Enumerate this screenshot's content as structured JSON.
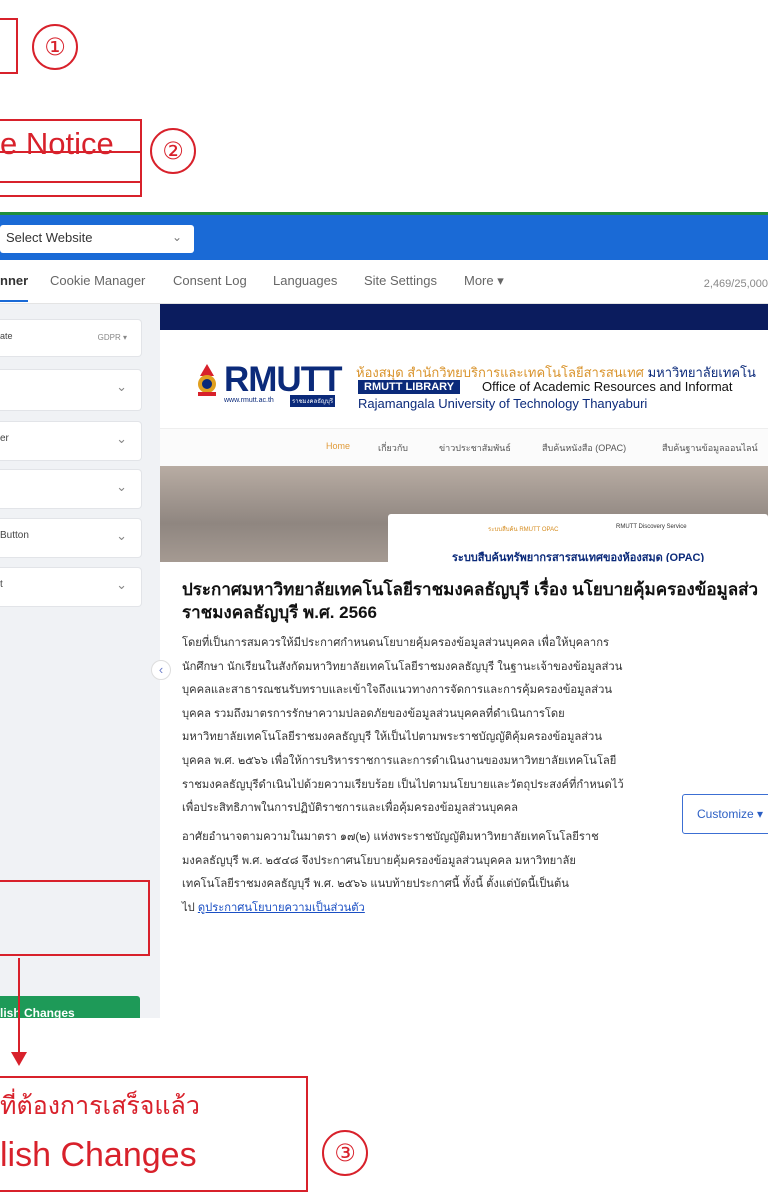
{
  "annotations": {
    "step1_number": "①",
    "step2_label": "e Notice",
    "step2_number": "②",
    "step3_line1": "ที่ต้องการเสร็จแล้ว",
    "step3_line2": "lish Changes",
    "step3_number": "③",
    "color": "#d8212b"
  },
  "topbar": {
    "website_select": "Select Website",
    "accent_color": "#1a6ad6"
  },
  "nav": {
    "tabs": [
      "nner",
      "Cookie Manager",
      "Consent Log",
      "Languages",
      "Site Settings",
      "More ▾"
    ],
    "usage": "2,469/25,000"
  },
  "left_panel": {
    "template_label": "ate",
    "template_value": "GDPR ▾",
    "items": [
      "",
      "er",
      "",
      "Button",
      "t"
    ],
    "publish_label": "lish Changes",
    "publish_color": "#1e9a58"
  },
  "preview": {
    "logo_word": "RMUTT",
    "logo_site": "www.rmutt.ac.th",
    "logo_tag": "ราชมงคลธัญบุรี",
    "lib_thai_orange": "ห้องสมุด สำนักวิทยบริการและเทคโนโลยีสารสนเทศ",
    "lib_thai_dark": "มหาวิทยาลัยเทคโน",
    "lib_badge": "RMUTT LIBRARY",
    "lib_eng1": "Office of Academic Resources and Informat",
    "lib_eng2": "Rajamangala University of Technology Thanyaburi",
    "menu": [
      "Home",
      "เกี่ยวกับ",
      "ข่าวประชาสัมพันธ์",
      "สืบค้นหนังสือ (OPAC)",
      "สืบค้นฐานข้อมูลออนไลน์"
    ],
    "hero_tab1": "ระบบสืบค้น RMUTT OPAC",
    "hero_tab2": "RMUTT Discovery Service",
    "hero_title": "ระบบสืบค้นทรัพยากรสารสนเทศของห้องสมุด (OPAC)"
  },
  "notice": {
    "title_line1": "ประกาศมหาวิทยาลัยเทคโนโลยีราชมงคลธัญบุรี เรื่อง นโยบายคุ้มครองข้อมูลส่ว",
    "title_line2": "ราชมงคลธัญบุรี พ.ศ. 2566",
    "p1": [
      "โดยที่เป็นการสมควรให้มีประกาศกำหนดนโยบายคุ้มครองข้อมูลส่วนบุคคล เพื่อให้บุคลากร",
      "นักศึกษา นักเรียนในสังกัดมหาวิทยาลัยเทคโนโลยีราชมงคลธัญบุรี ในฐานะเจ้าของข้อมูลส่วน",
      "บุคคลและสาธารณชนรับทราบและเข้าใจถึงแนวทางการจัดการและการคุ้มครองข้อมูลส่วน",
      "บุคคล รวมถึงมาตรการรักษาความปลอดภัยของข้อมูลส่วนบุคคลที่ดำเนินการโดย",
      "มหาวิทยาลัยเทคโนโลยีราชมงคลธัญบุรี ให้เป็นไปตามพระราชบัญญัติคุ้มครองข้อมูลส่วน",
      "บุคคล พ.ศ. ๒๕๖๖ เพื่อให้การบริหารราชการและการดำเนินงานของมหาวิทยาลัยเทคโนโลยี",
      "ราชมงคลธัญบุรีดำเนินไปด้วยความเรียบร้อย เป็นไปตามนโยบายและวัตถุประสงค์ที่กำหนดไว้",
      "เพื่อประสิทธิภาพในการปฏิบัติราชการและเพื่อคุ้มครองข้อมูลส่วนบุคคล"
    ],
    "p2": [
      "อาศัยอำนาจตามความในมาตรา ๑๗(๒) แห่งพระราชบัญญัติมหาวิทยาลัยเทคโนโลยีราช",
      "มงคลธัญบุรี พ.ศ. ๒๕๔๘ จึงประกาศนโยบายคุ้มครองข้อมูลส่วนบุคคล มหาวิทยาลัย",
      "เทคโนโลยีราชมงคลธัญบุรี พ.ศ. ๒๕๖๖ แนบท้ายประกาศนี้ ทั้งนี้ ตั้งแต่บัดนี้เป็นต้น"
    ],
    "p2_last_prefix": "ไป ",
    "p2_link": "ดูประกาศนโยบายความเป็นส่วนตัว",
    "customize": "Customize ▾"
  }
}
